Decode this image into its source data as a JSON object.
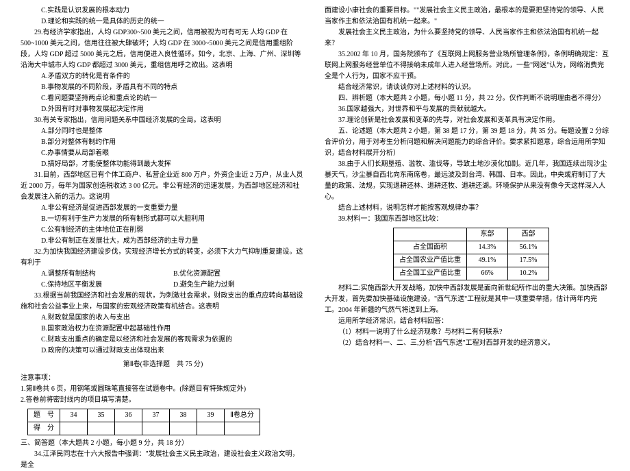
{
  "left": {
    "q28c": "C.实践是认识发展的根本动力",
    "q28d": "D.理论和实践的统一是具体的历史的统一",
    "q29": "29.有经济学家指出，人均 GDP300~500 美元之间，信用被视为可有可无 人均 GDP 在 500~1000 美元之间，信用往往被大肆破坏；人均 GDP 在 3000~5000 美元之间是信用重组阶段，人均 GDP 超过 5000 美元之后，信用便进入良性循环。如今，北京、上海、广州、深圳等沿海大中城市人均 GDP 都超过 3000 美元，重组信用呼之欲出。这表明",
    "q29a": "A.矛盾双方的转化是有条件的",
    "q29b": "B.事物发展的不同阶段，矛盾具有不同的特点",
    "q29c": "C.看问题要坚持两点论和重点论的统一",
    "q29d": "D.外因有时对事物发展起决定作用",
    "q30": "30.有关专家指出，信用问题关系中国经济发展的全局。这表明",
    "q30a": "A.部分同时也是整体",
    "q30b": "B.部分对整体有制约作用",
    "q30c": "C.办事情要从局部着眼",
    "q30d": "D.搞好局部，才能使整体功能得到最大发挥",
    "q31": "31.目前，西部地区已有个体工商户、私营企业近 800 万户，外资企业近 2 万户，从业人员近 2000 万，每年为国家创造税收达 3 00 亿元。非公有经济的迅速发展，为西部地区经济和社会发展注入新的活力。这说明",
    "q31a": "A.非公有经济是促进西部发展的一支重要力量",
    "q31b": "B.一切有利于生产力发展的所有制形式都可以大胆利用",
    "q31c": "C.公有制经济的主体地位正在削弱",
    "q31d": "D.非公有制正在发展壮大，成为西部经济的主导力量",
    "q32": "32.为加快我国经济建设步伐，实现经济增长方式的转变，必须下大力气抑制重复建设。这有利于",
    "q32a": "A.调整所有制结构",
    "q32b": "B.优化资源配置",
    "q32c": "C.保持地区平衡发展",
    "q32d": "D.避免生产能力过剩",
    "q33": "33.根据当前我国经济和社会发展的现状，为刺激社会需求，财政支出的重点应转向基础设施和社会公益事业上来，与国家的宏观经济政策有机结合。这表明",
    "q33a": "A.财政就是国家的收入与支出",
    "q33b": "B.国家政治权力在资源配置中起基础性作用",
    "q33c": "C.财政支出重点的确定是以经济和社会发展的客观需求为依据的",
    "q33d": "D.政府的决策可以通过财政支出体现出来",
    "section2": "第Ⅱ卷(非选择题　共 75 分)",
    "notice": "注意事项：",
    "notice1": "1.第Ⅱ卷共 6 页，用钢笔或圆珠笔直接答在试题卷中。(除题目有特殊规定外)",
    "notice2": "2.答卷前将密封线内的项目填写清楚。",
    "th_num": "题　号",
    "th_score": "得　分",
    "nums": [
      "34",
      "35",
      "36",
      "37",
      "38",
      "39",
      "Ⅱ卷总分"
    ],
    "part3": "三、简答题（本大题共 2 小题，每小题 9 分，共 18 分）",
    "q34": "34.江泽民同志在十六大报告中强调：\"发展社会主义民主政治，建设社会主义政治文明，是全"
  },
  "right": {
    "cont": "面建设小康社会的重要目标。\"\"发展社会主义民主政治，最根本的是要把坚持党的领导、人民当家作主和依法治国有机统一起来。\"",
    "q34q": "发展社会主义民主政治，为什么要坚持党的领导、人民当家作主和依法治国有机统一起来？",
    "q35": "35.2002 年 10 月，国务院颁布了《互联网上网服务营业场所管理条例》，条例明确规定：互联网上网服务经营单位不得接纳未成年人进入经营场所。对此，一些\"网迷\"认为，网络消费完全是个人行为，国家不应干预。",
    "q35q": "结合经济常识，请谈谈你对上述材料的认识。",
    "part4": "四、辨析题（本大题共 2 小题，每小题 11 分，共 22 分。仅作判断不说明理由者不得分）",
    "q36": "36.国家越强大，对世界和平与发展的贡献就越大。",
    "q37": "37.理论创新是社会发展和变革的先导，对社会发展和变革具有决定作用。",
    "part5": "五、论述题（本大题共 2 小题，第 38 题 17 分，第 39 题 18 分，共 35 分。每题设置 2 分综合评价分，用于对考生分析问题和解决问题能力的综合评价。要求紧扣题意，综合运用所学知识，结合材料展开分析）",
    "q38": "38.由于人们长期垦殖、滥牧、滥伐等，导致土地沙漠化加剧。近几年，我国连续出现沙尘暴天气，沙尘暴自西北向东南席卷，最远波及到台湾、韩国、日本。因此，中央或府制订了大量的政策、法规，实现退耕还林、退耕还牧、退耕还湖。环境保护从来没有像今天这样深入人心。",
    "q38q": "结合上述材料，说明怎样才能按客观规律办事？",
    "q39": "39.材料一：我国东西部地区比较：",
    "tbl": {
      "h1": "",
      "h2": "东部",
      "h3": "西部",
      "r1": [
        "占全国面积",
        "14.3%",
        "56.1%"
      ],
      "r2": [
        "占全国农业产值比重",
        "49.1%",
        "17.5%"
      ],
      "r3": [
        "占全国工业产值比重",
        "66%",
        "10.2%"
      ]
    },
    "mat2": "材料二:实施西部大开发战略，加快中西部发展是面向新世纪所作出的重大决策。加快西部大开发，首先要加快基础设施建设，\"西气东送\"工程就是其中一项重要举措，估计两年内完工。2004 年新疆的气然气将送到上海。",
    "q39task": "运用所学经济常识，结合材料回答：",
    "q39_1": "（1）材料一说明了什么经济现象？与材料二有何联系?",
    "q39_2": "（2）结合材料一、二、三,分析\"西气东送\"工程对西部开发的经济意义。"
  }
}
